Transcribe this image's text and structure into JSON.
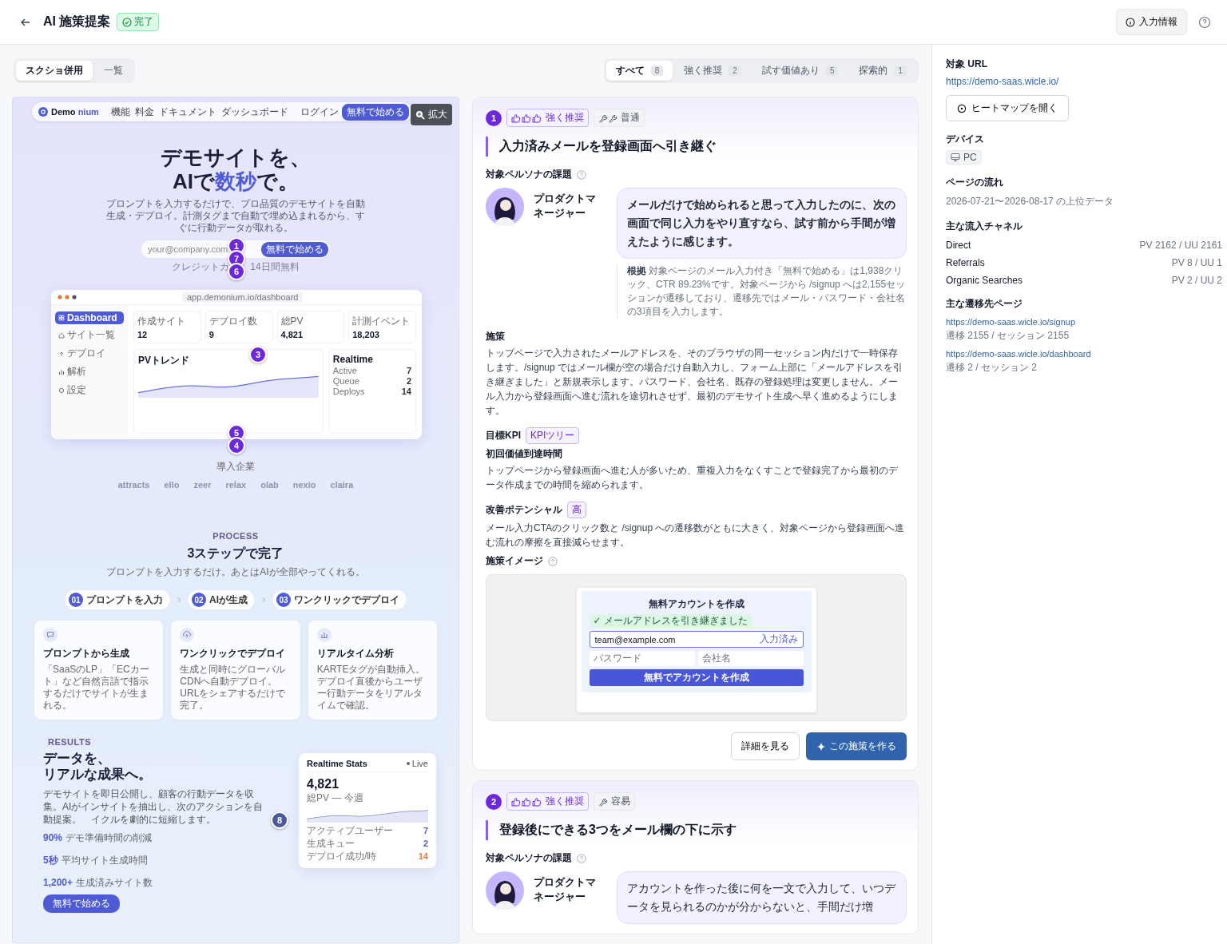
{
  "header": {
    "title": "AI 施策提案",
    "status": {
      "kind": "done",
      "label": "完了"
    },
    "info_button": "入力情報"
  },
  "view_toggle": [
    {
      "label": "スクショ併用",
      "selected": true
    },
    {
      "label": "一覧",
      "selected": false
    }
  ],
  "filters": [
    {
      "label": "すべて",
      "count": "8",
      "selected": true
    },
    {
      "label": "強く推奨",
      "count": "2",
      "selected": false
    },
    {
      "label": "試す価値あり",
      "count": "5",
      "selected": false
    },
    {
      "label": "探索的",
      "count": "1",
      "selected": false
    }
  ],
  "screenshot": {
    "zoom_button": "拡大",
    "site": {
      "brand": [
        "Demo",
        "nium"
      ],
      "nav_links": [
        "機能",
        "料金",
        "ドキュメント",
        "ダッシュボード"
      ],
      "login": "ログイン",
      "nav_cta": "無料で始める",
      "hero_title": "デモサイトを、",
      "hero_title_2": [
        {
          "text": "AIで",
          "accent": false
        },
        {
          "text": "数秒",
          "accent": true
        },
        {
          "text": "で。",
          "accent": false
        }
      ],
      "hero_text": "プロンプトを入力するだけで、プロ品質のデモサイトを自動生成・デプロイ。計測タグまで自動で埋め込まれるから、すぐに行動データが取れる。",
      "email_placeholder": "your@company.com",
      "hero_cta": "無料で始める",
      "note": [
        "クレジットカ",
        "14日間無料"
      ],
      "dashboard": {
        "url": "app.demonium.io/dashboard",
        "nav": [
          {
            "kind": "grid",
            "label": "Dashboard",
            "selected": true
          },
          {
            "kind": "home",
            "label": "サイト一覧",
            "selected": false
          },
          {
            "kind": "deploy",
            "label": "デプロイ",
            "selected": false
          },
          {
            "kind": "chart",
            "label": "解析",
            "selected": false
          },
          {
            "kind": "gear",
            "label": "設定",
            "selected": false
          }
        ],
        "stats": [
          {
            "label": "作成サイト",
            "value": "12"
          },
          {
            "label": "デプロイ数",
            "value": "9"
          },
          {
            "label": "総PV",
            "value": "4,821"
          },
          {
            "label": "計測イベント",
            "value": "18,203"
          }
        ],
        "chart_title": "PVトレンド",
        "realtime_title": "Realtime",
        "realtime_rows": [
          {
            "label": "Active",
            "value": "7"
          },
          {
            "label": "Queue",
            "value": "2"
          },
          {
            "label": "Deploys",
            "value": "14"
          }
        ]
      },
      "clients_heading": "導入企業",
      "clients": [
        "attracts",
        "ello",
        "zeer",
        "relax",
        "olab",
        "nexio",
        "claira"
      ],
      "process": {
        "tag": "PROCESS",
        "title": "3ステップで完了",
        "text": "プロンプトを入力するだけ。あとはAIが全部やってくれる。",
        "steps": [
          {
            "number": "01",
            "label": "プロンプトを入力"
          },
          {
            "number": "02",
            "label": "AIが生成"
          },
          {
            "number": "03",
            "label": "ワンクリックでデプロイ"
          }
        ],
        "features": [
          {
            "kind": "chat",
            "title": "プロンプトから生成",
            "text": "「SaaSのLP」「ECカート」など自然言語で指示するだけでサイトが生まれる。"
          },
          {
            "kind": "upload",
            "title": "ワンクリックでデプロイ",
            "text": "生成と同時にグローバルCDNへ自動デプロイ。URLをシェアするだけで完了。"
          },
          {
            "kind": "chart",
            "title": "リアルタイム分析",
            "text": "KARTEタグが自動挿入。デプロイ直後からユーザー行動データをリアルタイムで確認。"
          }
        ]
      },
      "results": {
        "tag": "RESULTS",
        "title": [
          "データを、",
          "リアルな成果へ。"
        ],
        "text": [
          "デモサイトを即日公開し、顧客の行動データを収集。AIがインサイトを抽出し、次のアクションを自動提案。",
          "イクルを劇的に短縮します。"
        ],
        "stats": [
          {
            "value": "90%",
            "label": "デモ準備時間の削減"
          },
          {
            "value": "5秒",
            "label": "平均サイト生成時間"
          },
          {
            "value": "1,200+",
            "label": "生成済みサイト数"
          }
        ],
        "cta": "無料で始める",
        "card": {
          "title": "Realtime Stats",
          "badge": "Live",
          "value": "4,821",
          "caption": "総PV — 今週",
          "rows": [
            {
              "label": "アクティブユーザー",
              "value": "7",
              "accent": false
            },
            {
              "label": "生成キュー",
              "value": "2",
              "accent": false
            },
            {
              "label": "デプロイ成功/時",
              "value": "14",
              "accent": true
            }
          ]
        }
      }
    },
    "markers": [
      {
        "label": "1",
        "color": "#6d28d9"
      },
      {
        "label": "7",
        "color": "#6d28d9"
      },
      {
        "label": "6",
        "color": "#6d28d9"
      },
      {
        "label": "3",
        "color": "#6d28d9"
      },
      {
        "label": "5",
        "color": "#6d28d9"
      },
      {
        "label": "4",
        "color": "#6d28d9"
      },
      {
        "label": "8",
        "color": "#4b5a9b"
      }
    ]
  },
  "proposals": [
    {
      "number": "1",
      "recommendation": {
        "kind": "strong",
        "label": "強く推奨"
      },
      "effort": {
        "kind": "normal",
        "label": "普通"
      },
      "title": "入力済みメールを登録画面へ引き継ぐ",
      "persona_heading": "対象ペルソナの課題",
      "persona": {
        "name": "プロダクトマネージャー",
        "emphasized": true,
        "quote": "メールだけで始められると思って入力したのに、次の画面で同じ入力をやり直すなら、試す前から手間が増えたように感じます。"
      },
      "evidence": "**根拠** 対象ページのメール入力付き「無料で始める」は1,938クリック、CTR 89.23%です。対象ページから /signup へは2,155セッションが遷移しており、遷移先ではメール・パスワード・会社名の3項目を入力します。",
      "measure": {
        "heading": "施策",
        "text": "トップページで入力されたメールアドレスを、そのブラウザの同一セッション内だけで一時保存します。/signup ではメール欄が空の場合だけ自動入力し、フォーム上部に「メールアドレスを引き継ぎました」と新規表示します。パスワード、会社名、既存の登録処理は変更しません。メール入力から登録画面へ進む流れを途切れさせず、最初のデモサイト生成へ早く進めるようにします。"
      },
      "kpi": {
        "heading": "目標KPI",
        "badge": "KPIツリー",
        "name": "初回価値到達時間",
        "text": "トップページから登録画面へ進む人が多いため、重複入力をなくすことで登録完了から最初のデータ作成までの時間を縮められます。"
      },
      "potential": {
        "heading": "改善ポテンシャル",
        "badge": "高",
        "text": "メール入力CTAのクリック数と /signup への遷移数がともに大きく、対象ページから登録画面へ進む流れの摩擦を直接減らせます。"
      },
      "image": {
        "heading": "施策イメージ",
        "form": {
          "title": "無料アカウントを作成",
          "notice": "✓ メールアドレスを引き継ぎました",
          "email": "team@example.com",
          "filled_tag": "入力済み",
          "password_placeholder": "パスワード",
          "company_placeholder": "会社名",
          "submit": "無料でアカウントを作成"
        }
      },
      "actions": {
        "secondary": "詳細を見る",
        "primary": "この施策を作る"
      }
    },
    {
      "number": "2",
      "recommendation": {
        "kind": "strong",
        "label": "強く推奨"
      },
      "effort": {
        "kind": "easy",
        "label": "容易"
      },
      "title": "登録後にできる3つをメール欄の下に示す",
      "persona_heading": "対象ペルソナの課題",
      "persona": {
        "name": "プロダクトマネージャー",
        "emphasized": false,
        "quote": "アカウントを作った後に何を一文で入力して、いつデータを見られるのかが分からないと、手間だけ増"
      }
    }
  ],
  "sidebar": {
    "url_heading": "対象 URL",
    "url": "https://demo-saas.wicle.io/",
    "heatmap_button": "ヒートマップを開く",
    "device_heading": "デバイス",
    "device": "PC",
    "flow_heading": "ページの流れ",
    "flow_range": "2026-07-21〜2026-08-17 の上位データ",
    "channels_heading": "主な流入チャネル",
    "channels": [
      {
        "name": "Direct",
        "stat": "PV 2162 / UU 2161"
      },
      {
        "name": "Referrals",
        "stat": "PV 8 / UU 1"
      },
      {
        "name": "Organic Searches",
        "stat": "PV 2 / UU 2"
      }
    ],
    "destinations_heading": "主な遷移先ページ",
    "destinations": [
      {
        "url": "https://demo-saas.wicle.io/signup",
        "stat": "遷移 2155 / セッション 2155"
      },
      {
        "url": "https://demo-saas.wicle.io/dashboard",
        "stat": "遷移 2 / セッション 2"
      }
    ]
  }
}
